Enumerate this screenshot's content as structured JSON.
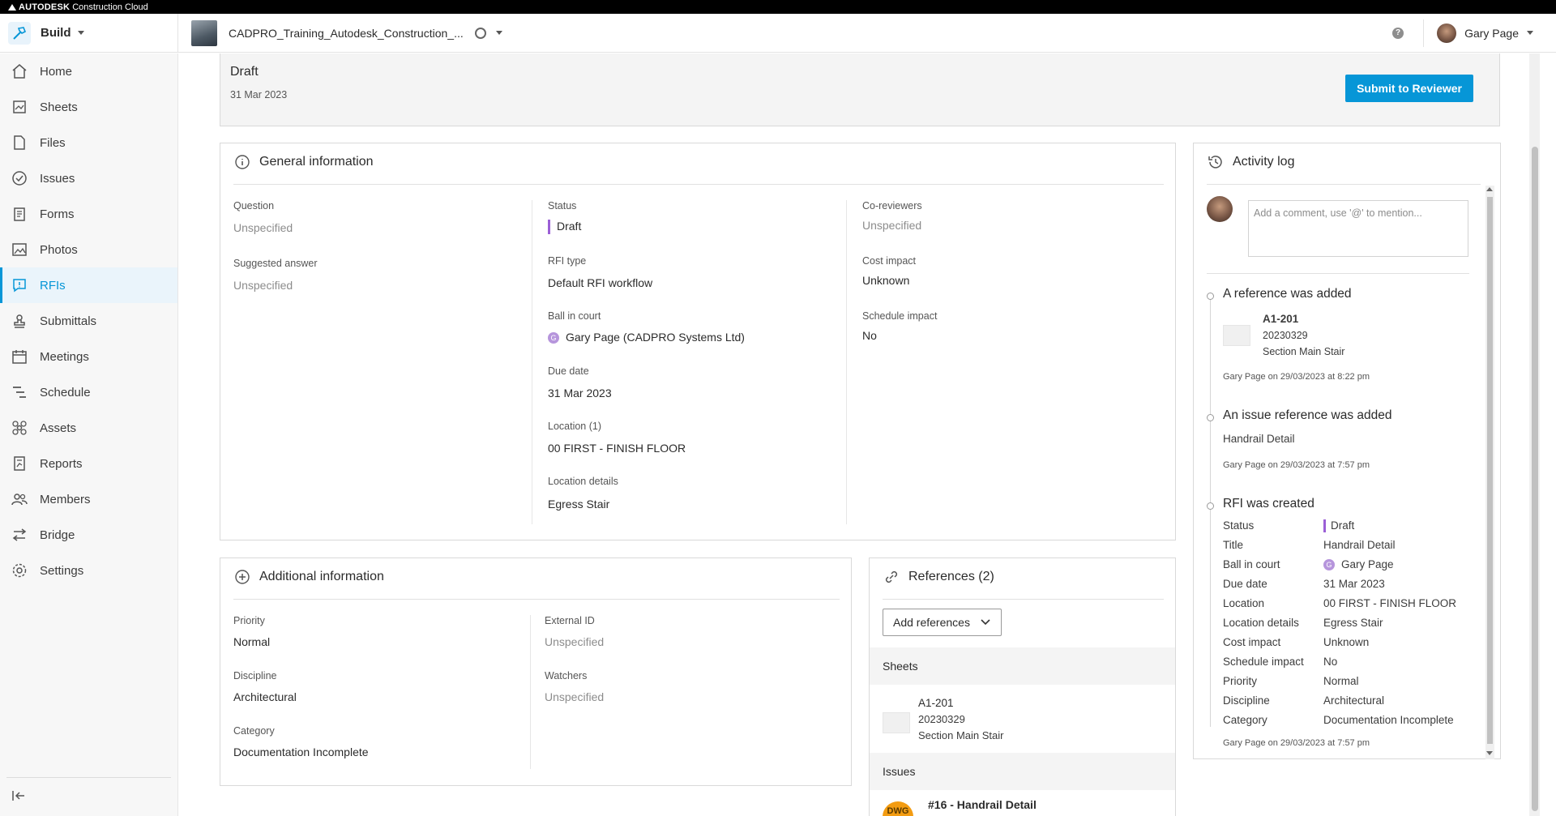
{
  "brand": {
    "name": "AUTODESK",
    "product": "Construction Cloud"
  },
  "header": {
    "module": "Build",
    "project": "CADPRO_Training_Autodesk_Construction_...",
    "help": "?",
    "user": "Gary Page"
  },
  "sidebar": {
    "items": [
      {
        "label": "Home",
        "icon": "home-icon"
      },
      {
        "label": "Sheets",
        "icon": "sheets-icon"
      },
      {
        "label": "Files",
        "icon": "files-icon"
      },
      {
        "label": "Issues",
        "icon": "issues-icon"
      },
      {
        "label": "Forms",
        "icon": "forms-icon"
      },
      {
        "label": "Photos",
        "icon": "photos-icon"
      },
      {
        "label": "RFIs",
        "icon": "rfis-icon"
      },
      {
        "label": "Submittals",
        "icon": "submittals-icon"
      },
      {
        "label": "Meetings",
        "icon": "meetings-icon"
      },
      {
        "label": "Schedule",
        "icon": "schedule-icon"
      },
      {
        "label": "Assets",
        "icon": "assets-icon"
      },
      {
        "label": "Reports",
        "icon": "reports-icon"
      },
      {
        "label": "Members",
        "icon": "members-icon"
      },
      {
        "label": "Bridge",
        "icon": "bridge-icon"
      },
      {
        "label": "Settings",
        "icon": "settings-icon"
      }
    ],
    "active": "RFIs"
  },
  "draft": {
    "title": "Draft",
    "date": "31 Mar 2023",
    "submit_label": "Submit to Reviewer"
  },
  "general": {
    "title": "General information",
    "question_label": "Question",
    "question_value": "Unspecified",
    "suggested_label": "Suggested answer",
    "suggested_value": "Unspecified",
    "status_label": "Status",
    "status_value": "Draft",
    "rfi_type_label": "RFI type",
    "rfi_type_value": "Default RFI workflow",
    "ball_label": "Ball in court",
    "ball_badge": "G",
    "ball_value": "Gary Page (CADPRO Systems Ltd)",
    "due_label": "Due date",
    "due_value": "31 Mar 2023",
    "location_label": "Location (1)",
    "location_value": "00 FIRST - FINISH FLOOR",
    "location_details_label": "Location details",
    "location_details_value": "Egress Stair",
    "coreviewers_label": "Co-reviewers",
    "coreviewers_value": "Unspecified",
    "cost_label": "Cost impact",
    "cost_value": "Unknown",
    "schedule_label": "Schedule impact",
    "schedule_value": "No"
  },
  "additional": {
    "title": "Additional information",
    "priority_label": "Priority",
    "priority_value": "Normal",
    "discipline_label": "Discipline",
    "discipline_value": "Architectural",
    "category_label": "Category",
    "category_value": "Documentation Incomplete",
    "external_label": "External ID",
    "external_value": "Unspecified",
    "watchers_label": "Watchers",
    "watchers_value": "Unspecified"
  },
  "references": {
    "title": "References (2)",
    "add_label": "Add references",
    "sheets_label": "Sheets",
    "sheet": {
      "name": "A1-201",
      "version": "20230329",
      "desc": "Section Main Stair"
    },
    "issues_label": "Issues",
    "issue_badge": "DWG",
    "issue_title": "#16 - Handrail Detail"
  },
  "activity": {
    "title": "Activity log",
    "comment_placeholder": "Add a comment, use '@' to mention...",
    "entries": [
      {
        "title": "A reference was added",
        "sheet_name": "A1-201",
        "sheet_version": "20230329",
        "sheet_desc": "Section Main Stair",
        "meta": "Gary Page on 29/03/2023 at 8:22 pm"
      },
      {
        "title": "An issue reference was added",
        "detail": "Handrail Detail",
        "meta": "Gary Page on 29/03/2023 at 7:57 pm"
      },
      {
        "title": "RFI was created",
        "rows": [
          {
            "k": "Status",
            "v": "Draft"
          },
          {
            "k": "Title",
            "v": "Handrail Detail"
          },
          {
            "k": "Ball in court",
            "v": "Gary Page",
            "badge": "G"
          },
          {
            "k": "Due date",
            "v": "31 Mar 2023"
          },
          {
            "k": "Location",
            "v": "00 FIRST - FINISH FLOOR"
          },
          {
            "k": "Location details",
            "v": "Egress Stair"
          },
          {
            "k": "Cost impact",
            "v": "Unknown"
          },
          {
            "k": "Schedule impact",
            "v": "No"
          },
          {
            "k": "Priority",
            "v": "Normal"
          },
          {
            "k": "Discipline",
            "v": "Architectural"
          },
          {
            "k": "Category",
            "v": "Documentation Incomplete"
          }
        ],
        "meta": "Gary Page on 29/03/2023 at 7:57 pm"
      }
    ]
  },
  "colors": {
    "accent": "#0696d7",
    "status_draft": "#9b5fd6",
    "badge": "#b695dc",
    "issue_badge": "#f39c12"
  }
}
